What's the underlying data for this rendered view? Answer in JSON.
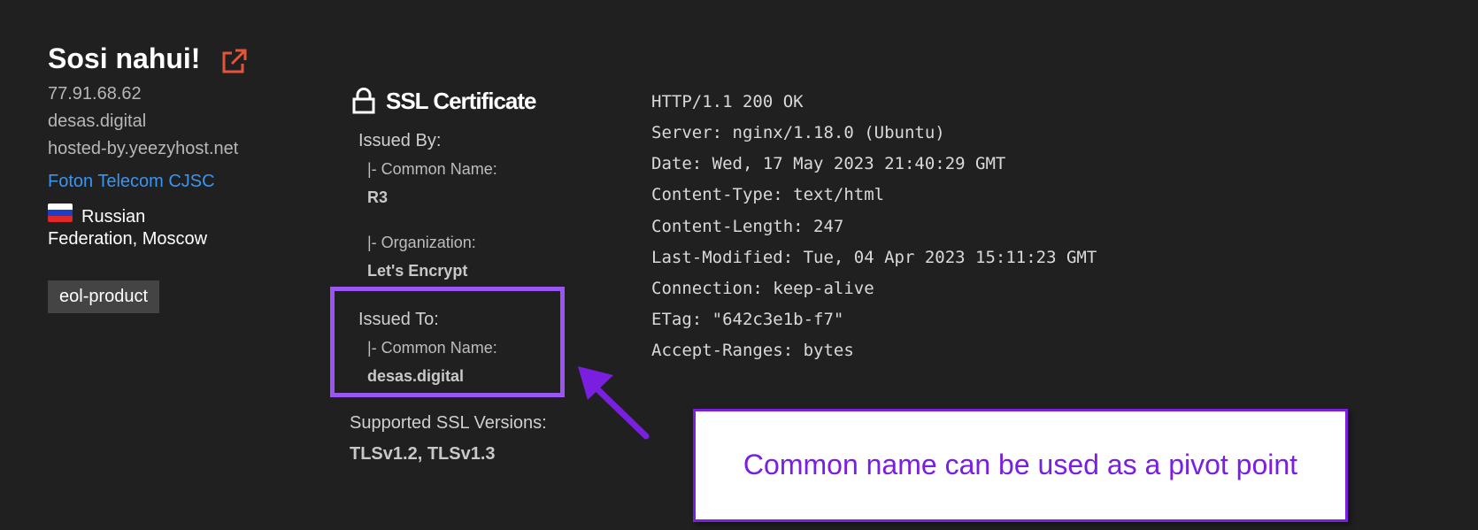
{
  "host": {
    "title": "Sosi nahui!",
    "ip": "77.91.68.62",
    "domain": "desas.digital",
    "hostname": "hosted-by.yeezyhost.net",
    "isp": "Foton Telecom CJSC",
    "country_line1": "Russian",
    "country_line2": "Federation",
    "separator": ",",
    "city": "Moscow",
    "tag": "eol-product",
    "link_color": "#3b94f0",
    "icons": [
      "external-link-icon",
      "russia-flag-icon"
    ]
  },
  "ssl": {
    "title": "SSL Certificate",
    "icon": "lock-icon",
    "issued_by_label": "Issued By:",
    "issued_by_cn_label": "|- Common Name:",
    "issued_by_cn": "R3",
    "issued_by_org_label": "|- Organization:",
    "issued_by_org": "Let's Encrypt",
    "issued_to_label": "Issued To:",
    "issued_to_cn_label": "|- Common Name:",
    "issued_to_cn": "desas.digital",
    "versions_label": "Supported SSL Versions:",
    "versions": "TLSv1.2, TLSv1.3"
  },
  "http_headers": [
    "HTTP/1.1 200 OK",
    "Server: nginx/1.18.0 (Ubuntu)",
    "Date: Wed, 17 May 2023 21:40:29 GMT",
    "Content-Type: text/html",
    "Content-Length: 247",
    "Last-Modified: Tue, 04 Apr 2023 15:11:23 GMT",
    "Connection: keep-alive",
    "ETag: \"642c3e1b-f7\"",
    "Accept-Ranges: bytes"
  ],
  "annotation": {
    "text": "Common name can be used as a pivot point",
    "color": "#7a1fe0",
    "highlight_color": "#9a55f2",
    "icon": "arrow-icon"
  }
}
